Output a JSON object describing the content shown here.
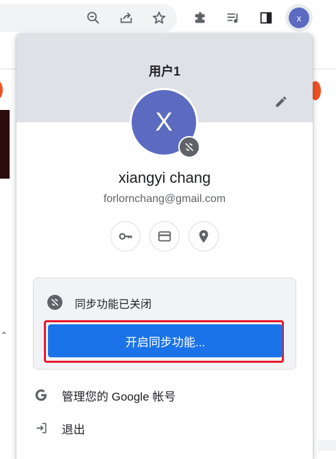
{
  "toolbar": {
    "avatar_initial": "x",
    "icons": [
      "zoom-out-icon",
      "share-icon",
      "star-icon",
      "extensions-icon",
      "media-control-icon",
      "side-panel-icon"
    ]
  },
  "profile_menu": {
    "profile_name": "用户1",
    "avatar_initial": "X",
    "full_name": "xiangyi chang",
    "email": "forlornchang@gmail.com",
    "quick_actions": [
      "key-icon",
      "credit-card-icon",
      "location-pin-icon"
    ],
    "sync": {
      "status_text": "同步功能已关闭",
      "button_label": "开启同步功能..."
    },
    "items": [
      {
        "label": "管理您的 Google 帐号",
        "icon": "google-icon"
      },
      {
        "label": "退出",
        "icon": "sign-out-icon"
      }
    ]
  },
  "colors": {
    "accent": "#1a73e8",
    "avatar": "#5c6bc0",
    "highlight": "#e8182c",
    "header": "#dee1e6"
  }
}
